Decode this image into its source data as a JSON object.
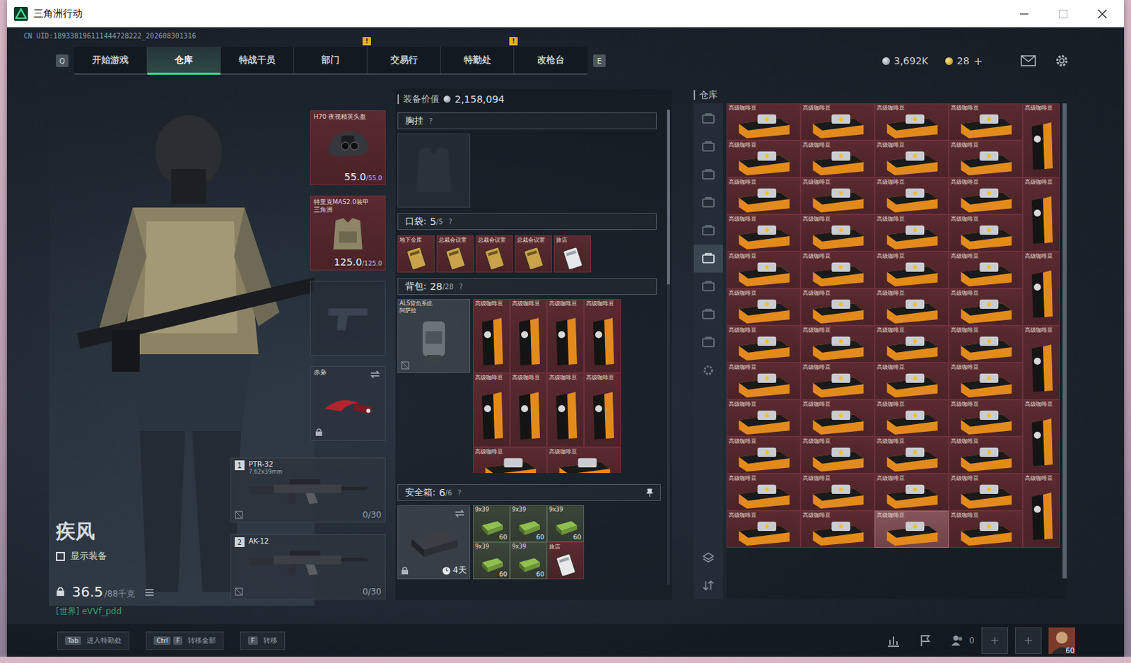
{
  "window": {
    "title": "三角洲行动"
  },
  "uid": "CN UID:189338196111444728222_202608301316",
  "nav": {
    "prev_key": "Q",
    "next_key": "E",
    "tabs": [
      {
        "label": "开始游戏",
        "selected": false,
        "badge": ""
      },
      {
        "label": "仓库",
        "selected": true,
        "badge": ""
      },
      {
        "label": "特战干员",
        "selected": false,
        "badge": ""
      },
      {
        "label": "部门",
        "selected": false,
        "badge": "!"
      },
      {
        "label": "交易行",
        "selected": false,
        "badge": ""
      },
      {
        "label": "特勤处",
        "selected": false,
        "badge": "!"
      },
      {
        "label": "改枪台",
        "selected": false,
        "badge": ""
      }
    ]
  },
  "wallet": {
    "coins": "3,692K",
    "tokens": "28",
    "add": "+"
  },
  "operator": {
    "name": "疾风",
    "show_gear": {
      "label": "显示装备",
      "checked": false
    },
    "weight": "36.5",
    "weight_max": "/88千克",
    "chat": "[世界] eVVf_pdd"
  },
  "equipment": {
    "helmet": {
      "name": "H70 夜视精英头盔",
      "durability": "55.0",
      "max": "/55.0"
    },
    "armor": {
      "name": "特里克MAS2.0装甲",
      "subname": "三角洲",
      "durability": "125.0",
      "max": "/125.0"
    },
    "melee": {
      "name": "赤枭"
    },
    "weapons": [
      {
        "slot": "1",
        "name": "PTR-32",
        "caliber": "7.62x39mm",
        "ammo": "0/30"
      },
      {
        "slot": "2",
        "name": "AK-12",
        "caliber": "",
        "ammo": "0/30"
      }
    ]
  },
  "loadout": {
    "value_label": "装备价值",
    "value": "2,158,094",
    "chest": {
      "label": "胸挂",
      "help": "?"
    },
    "pockets": {
      "label": "口袋:",
      "count": "5",
      "max": "/5",
      "help": "?",
      "items": [
        {
          "name": "地下金库",
          "kind": "gold"
        },
        {
          "name": "总裁会议室",
          "kind": "gold"
        },
        {
          "name": "总裁会议室",
          "kind": "gold"
        },
        {
          "name": "总裁会议室",
          "kind": "gold"
        },
        {
          "name": "旅店",
          "kind": "silver"
        }
      ]
    },
    "backpack": {
      "label": "背包:",
      "count": "28",
      "max": "/28",
      "help": "?",
      "bag_name": "ALS背负系统",
      "bag_sub": "阿萨拉",
      "items": [
        {
          "name": "高级咖啡豆"
        },
        {
          "name": "高级咖啡豆"
        },
        {
          "name": "高级咖啡豆"
        },
        {
          "name": "高级咖啡豆"
        },
        {
          "name": "高级咖啡豆"
        },
        {
          "name": "高级咖啡豆"
        },
        {
          "name": "高级咖啡豆"
        },
        {
          "name": "高级咖啡豆"
        }
      ],
      "partial_items": [
        {
          "name": "高级咖啡豆"
        },
        {
          "name": "高级咖啡豆"
        }
      ]
    },
    "safe": {
      "label": "安全箱:",
      "count": "6",
      "max": "/6",
      "help": "?",
      "timer": "4天",
      "items": [
        {
          "name": "9x39",
          "count": "60",
          "kind": "ammo"
        },
        {
          "name": "9x39",
          "count": "60",
          "kind": "ammo"
        },
        {
          "name": "9x39",
          "count": "60",
          "kind": "ammo"
        },
        {
          "name": "9x39",
          "count": "60",
          "kind": "ammo"
        },
        {
          "name": "9x39",
          "count": "60",
          "kind": "ammo"
        },
        {
          "name": "旅店",
          "count": "",
          "kind": "card"
        }
      ]
    }
  },
  "warehouse": {
    "title": "仓库",
    "tabs": [
      {
        "selected": false
      },
      {
        "selected": false
      },
      {
        "selected": false
      },
      {
        "selected": false
      },
      {
        "selected": false
      },
      {
        "selected": true
      },
      {
        "selected": false
      },
      {
        "selected": false
      },
      {
        "selected": false
      }
    ],
    "wide_items": [
      {
        "name": "高级咖啡豆",
        "selected": false
      },
      {
        "name": "高级咖啡豆",
        "selected": false
      },
      {
        "name": "高级咖啡豆",
        "selected": false
      },
      {
        "name": "高级咖啡豆",
        "selected": false
      },
      {
        "name": "高级咖啡豆",
        "selected": false
      },
      {
        "name": "高级咖啡豆",
        "selected": false
      },
      {
        "name": "高级咖啡豆",
        "selected": false
      },
      {
        "name": "高级咖啡豆",
        "selected": false
      },
      {
        "name": "高级咖啡豆",
        "selected": false
      },
      {
        "name": "高级咖啡豆",
        "selected": false
      },
      {
        "name": "高级咖啡豆",
        "selected": false
      },
      {
        "name": "高级咖啡豆",
        "selected": false
      },
      {
        "name": "高级咖啡豆",
        "selected": false
      },
      {
        "name": "高级咖啡豆",
        "selected": false
      },
      {
        "name": "高级咖啡豆",
        "selected": false
      },
      {
        "name": "高级咖啡豆",
        "selected": false
      },
      {
        "name": "高级咖啡豆",
        "selected": false
      },
      {
        "name": "高级咖啡豆",
        "selected": false
      },
      {
        "name": "高级咖啡豆",
        "selected": false
      },
      {
        "name": "高级咖啡豆",
        "selected": false
      },
      {
        "name": "高级咖啡豆",
        "selected": false
      },
      {
        "name": "高级咖啡豆",
        "selected": false
      },
      {
        "name": "高级咖啡豆",
        "selected": false
      },
      {
        "name": "高级咖啡豆",
        "selected": false
      },
      {
        "name": "高级咖啡豆",
        "selected": false
      },
      {
        "name": "高级咖啡豆",
        "selected": false
      },
      {
        "name": "高级咖啡豆",
        "selected": false
      },
      {
        "name": "高级咖啡豆",
        "selected": false
      },
      {
        "name": "高级咖啡豆",
        "selected": false
      },
      {
        "name": "高级咖啡豆",
        "selected": false
      },
      {
        "name": "高级咖啡豆",
        "selected": false
      },
      {
        "name": "高级咖啡豆",
        "selected": false
      },
      {
        "name": "高级咖啡豆",
        "selected": false
      },
      {
        "name": "高级咖啡豆",
        "selected": false
      },
      {
        "name": "高级咖啡豆",
        "selected": false
      },
      {
        "name": "高级咖啡豆",
        "selected": false
      },
      {
        "name": "高级咖啡豆",
        "selected": false
      },
      {
        "name": "高级咖啡豆",
        "selected": false
      },
      {
        "name": "高级咖啡豆",
        "selected": false
      },
      {
        "name": "高级咖啡豆",
        "selected": false
      },
      {
        "name": "高级咖啡豆",
        "selected": false
      },
      {
        "name": "高级咖啡豆",
        "selected": false
      },
      {
        "name": "高级咖啡豆",
        "selected": false
      },
      {
        "name": "高级咖啡豆",
        "selected": false
      },
      {
        "name": "高级咖啡豆",
        "selected": false
      },
      {
        "name": "高级咖啡豆",
        "selected": false
      },
      {
        "name": "高级咖啡豆",
        "selected": true
      },
      {
        "name": "高级咖啡豆",
        "selected": false
      }
    ],
    "tall_items": [
      {
        "name": "高级咖啡豆"
      },
      {
        "name": "高级咖啡豆"
      },
      {
        "name": "高级咖啡豆"
      },
      {
        "name": "高级咖啡豆"
      },
      {
        "name": "高级咖啡豆"
      },
      {
        "name": "高级咖啡豆"
      }
    ]
  },
  "bottom_bar": {
    "hints": [
      {
        "keys": [
          "Tab"
        ],
        "label": "进入特勤处"
      },
      {
        "keys": [
          "Ctrl",
          "F"
        ],
        "label": "转移全部"
      },
      {
        "keys": [
          "F"
        ],
        "label": "转移"
      }
    ],
    "squad_count": "0",
    "add_slots": [
      "+",
      "+"
    ],
    "level": "60"
  }
}
